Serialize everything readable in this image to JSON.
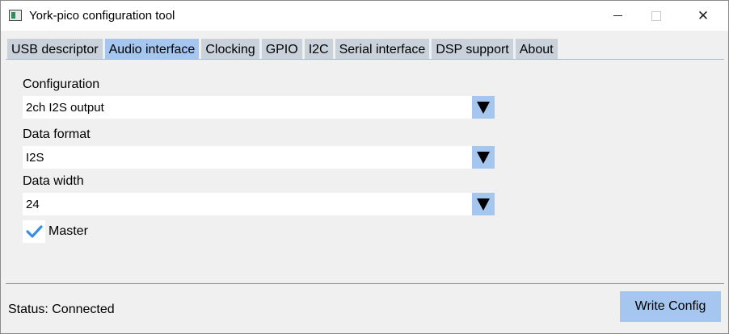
{
  "window": {
    "title": "York-pico configuration tool",
    "close_glyph": "✕"
  },
  "tabs": [
    {
      "label": "USB descriptor"
    },
    {
      "label": "Audio interface",
      "active": true
    },
    {
      "label": "Clocking"
    },
    {
      "label": "GPIO"
    },
    {
      "label": "I2C"
    },
    {
      "label": "Serial interface"
    },
    {
      "label": "DSP support"
    },
    {
      "label": "About"
    }
  ],
  "audio": {
    "configuration": {
      "label": "Configuration",
      "value": "2ch I2S output"
    },
    "data_format": {
      "label": "Data format",
      "value": "I2S"
    },
    "data_width": {
      "label": "Data width",
      "value": "24"
    },
    "master": {
      "label": "Master",
      "checked": true
    }
  },
  "footer": {
    "status": "Status: Connected",
    "write_button": "Write Config"
  },
  "colors": {
    "accent": "#a5c6ef",
    "tab_inactive": "#c9d2db",
    "check": "#3b8ee8",
    "background": "#f0f0f0"
  },
  "icons": {
    "app": "app-window-icon",
    "dropdown": "triangle-down-icon",
    "check": "checkmark-icon"
  }
}
